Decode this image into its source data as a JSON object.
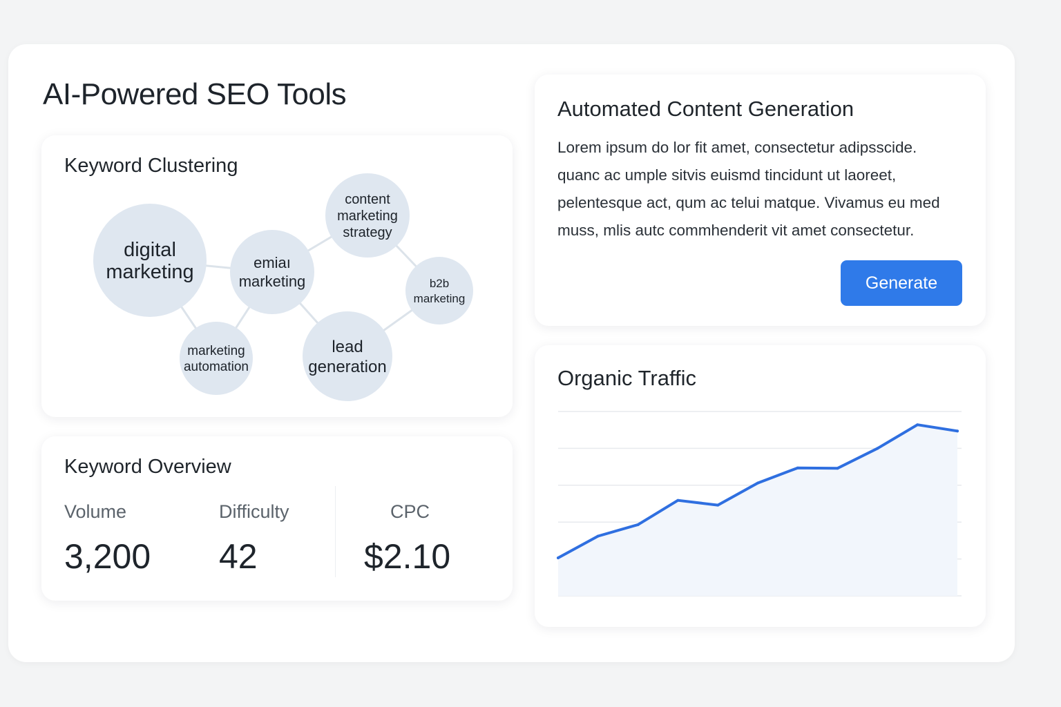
{
  "page": {
    "title": "AI-Powered SEO Tools"
  },
  "keyword_clustering": {
    "title": "Keyword Clustering",
    "clusters": [
      {
        "id": "digital-marketing",
        "lines": [
          "digital",
          "marketing"
        ]
      },
      {
        "id": "email-marketing",
        "lines": [
          "emiaı",
          "marketing"
        ]
      },
      {
        "id": "content-marketing-strategy",
        "lines": [
          "content",
          "marketing",
          "strategy"
        ]
      },
      {
        "id": "b2b-marketing",
        "lines": [
          "b2b",
          "marketing"
        ]
      },
      {
        "id": "marketing-automation",
        "lines": [
          "marketing",
          "automation"
        ]
      },
      {
        "id": "lead-generation",
        "lines": [
          "lead",
          "generation"
        ]
      }
    ]
  },
  "keyword_overview": {
    "title": "Keyword Overview",
    "metrics": [
      {
        "label": "Volume",
        "value": "3,200"
      },
      {
        "label": "Difficulty",
        "value": "42"
      },
      {
        "label": "CPC",
        "value": "$2.10"
      }
    ]
  },
  "content_generation": {
    "title": "Automated Content Generation",
    "body_lines": [
      "Lorem ipsum do lor fit amet, consectetur adipsscide.",
      "quanc ac umple sitvis euismd tincidunt ut laoreet,",
      "pelentesque act, qum ac telui matque. Vivamus eu med",
      "muss, mlis autc commhenderit vit amet consectetur."
    ],
    "button_label": "Generate"
  },
  "organic_traffic": {
    "title": "Organic Traffic",
    "line_color": "#2f6fe0",
    "fill_color": "#f2f6fc"
  },
  "chart_data": {
    "type": "area",
    "title": "Organic Traffic",
    "xlabel": "",
    "ylabel": "",
    "grid": true,
    "ylim": [
      0,
      5
    ],
    "x": [
      0,
      1,
      2,
      3,
      4,
      5,
      6,
      7,
      8,
      9,
      10
    ],
    "values": [
      1.03,
      1.62,
      1.93,
      2.59,
      2.46,
      3.06,
      3.47,
      3.46,
      4.0,
      4.64,
      4.47
    ]
  },
  "colors": {
    "accent": "#2f7ae9",
    "bubble_fill": "#dfe7f0",
    "connector": "#dce3ea",
    "background": "#f3f4f5"
  }
}
